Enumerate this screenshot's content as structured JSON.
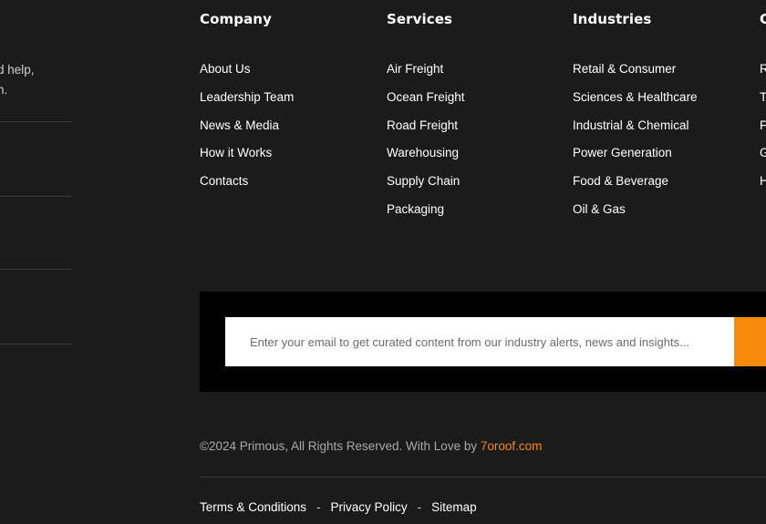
{
  "left_panel": {
    "lines": [
      "d help,",
      "n."
    ]
  },
  "columns": [
    {
      "heading": "Company",
      "links": [
        "About Us",
        "Leadership Team",
        "News & Media",
        "How it Works",
        "Contacts"
      ]
    },
    {
      "heading": "Services",
      "links": [
        "Air Freight",
        "Ocean Freight",
        "Road Freight",
        "Warehousing",
        "Supply Chain",
        "Packaging"
      ]
    },
    {
      "heading": "Industries",
      "links": [
        "Retail & Consumer",
        "Sciences & Healthcare",
        "Industrial & Chemical",
        "Power Generation",
        "Food & Beverage",
        "Oil & Gas"
      ]
    },
    {
      "heading": "C",
      "links": [
        "R",
        "T",
        "F",
        "G",
        "H"
      ]
    }
  ],
  "subscribe": {
    "placeholder": "Enter your email to get curated content from our industry alerts, news and insights..."
  },
  "copyright": {
    "text": "©2024 Primous, All Rights Reserved. With Love by ",
    "link_text": "7oroof.com"
  },
  "legal": {
    "links": [
      "Terms & Conditions",
      "Privacy Policy",
      "Sitemap"
    ],
    "separator": "-"
  },
  "colors": {
    "background": "#1b1b1b",
    "panel": "#000000",
    "accent": "#f68a0a"
  }
}
